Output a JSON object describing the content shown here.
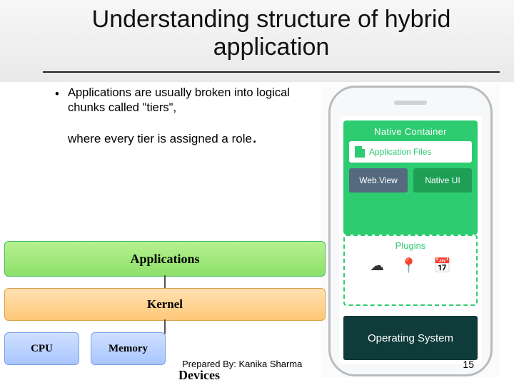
{
  "slide": {
    "title": "Understanding structure of hybrid application",
    "bullet_line1": "Applications are usually broken into logical chunks called \"tiers\",",
    "bullet_line2_pre": "where every tier is assigned a role",
    "bullet_line2_period": "."
  },
  "phone": {
    "native_container_label": "Native Container",
    "application_files_label": "Application Files",
    "webview_label": "Web.View",
    "nativeui_label": "Native UI",
    "plugins_label": "Plugins",
    "os_label": "Operating System",
    "icons": {
      "cloud": "cloud-icon",
      "pin": "map-pin-icon",
      "calendar": "calendar-icon"
    }
  },
  "layers": {
    "applications": "Applications",
    "kernel": "Kernel",
    "cpu": "CPU",
    "memory": "Memory",
    "devices_label": "Devices"
  },
  "footer": {
    "prepared_by": "Prepared By: Kanika Sharma",
    "slide_number": "15"
  }
}
